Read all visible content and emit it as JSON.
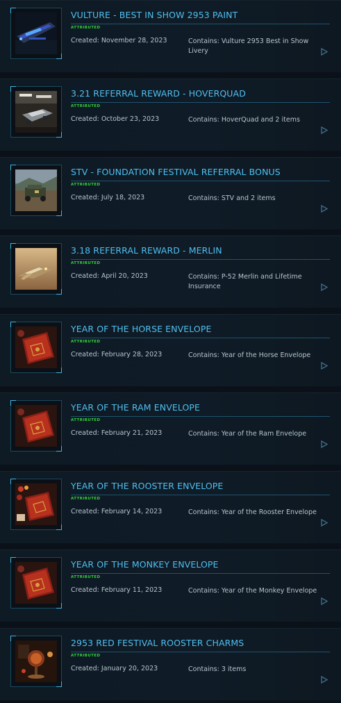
{
  "items": [
    {
      "title": "VULTURE - BEST IN SHOW 2953 PAINT",
      "badge": "ATTRIBUTED",
      "created": "Created: November 28, 2023",
      "contains": "Contains: Vulture 2953 Best in Show Livery",
      "thumb": "ship-vulture"
    },
    {
      "title": "3.21 REFERRAL REWARD - HOVERQUAD",
      "badge": "ATTRIBUTED",
      "created": "Created: October 23, 2023",
      "contains": "Contains: HoverQuad and 2 items",
      "thumb": "hoverquad"
    },
    {
      "title": "STV - FOUNDATION FESTIVAL REFERRAL BONUS",
      "badge": "ATTRIBUTED",
      "created": "Created: July 18, 2023",
      "contains": "Contains: STV and 2 items",
      "thumb": "stv"
    },
    {
      "title": "3.18 REFERRAL REWARD - MERLIN",
      "badge": "ATTRIBUTED",
      "created": "Created: April 20, 2023",
      "contains": "Contains: P-52 Merlin and Lifetime Insurance",
      "thumb": "merlin"
    },
    {
      "title": "YEAR OF THE HORSE ENVELOPE",
      "badge": "ATTRIBUTED",
      "created": "Created: February 28, 2023",
      "contains": "Contains: Year of the Horse Envelope",
      "thumb": "envelope"
    },
    {
      "title": "YEAR OF THE RAM ENVELOPE",
      "badge": "ATTRIBUTED",
      "created": "Created: February 21, 2023",
      "contains": "Contains: Year of the Ram Envelope",
      "thumb": "envelope"
    },
    {
      "title": "YEAR OF THE ROOSTER ENVELOPE",
      "badge": "ATTRIBUTED",
      "created": "Created: February 14, 2023",
      "contains": "Contains: Year of the Rooster Envelope",
      "thumb": "envelope-table"
    },
    {
      "title": "YEAR OF THE MONKEY ENVELOPE",
      "badge": "ATTRIBUTED",
      "created": "Created: February 11, 2023",
      "contains": "Contains: Year of the Monkey Envelope",
      "thumb": "envelope"
    },
    {
      "title": "2953 RED FESTIVAL ROOSTER CHARMS",
      "badge": "ATTRIBUTED",
      "created": "Created: January 20, 2023",
      "contains": "Contains: 3 items",
      "thumb": "charms"
    }
  ],
  "colors": {
    "title": "#4fc0f0",
    "badge": "#36d13a",
    "text": "#b8c6d0",
    "accent": "#3fb6e6"
  },
  "icons": {
    "expand": "play-arrow-icon"
  }
}
